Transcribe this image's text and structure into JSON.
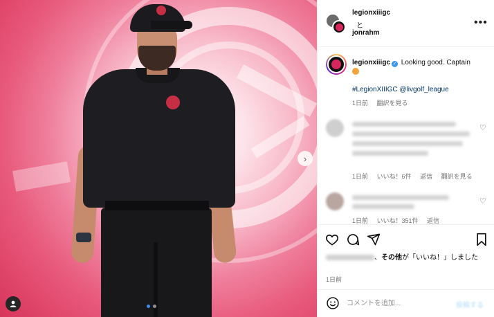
{
  "header": {
    "user1": "legionxiiigc",
    "conjunction": "と",
    "user2": "jonrahm",
    "more_icon": "more-horizontal-icon"
  },
  "caption": {
    "username": "legionxiiigc",
    "verified_icon": "verified-badge-icon",
    "text": "Looking good. Captain",
    "emoji_icon": "golf-emoji-icon",
    "tags": "#LegionXIIIGC @livgolf_league",
    "time": "1日前",
    "translate": "翻訳を見る"
  },
  "comments": [
    {
      "time": "1日前",
      "likes": "いいね！6件",
      "reply": "返信",
      "translate": "翻訳を見る"
    },
    {
      "time": "1日前",
      "likes": "いいね！351件",
      "reply": "返信"
    }
  ],
  "actions": {
    "like_icon": "heart-icon",
    "comment_icon": "comment-icon",
    "share_icon": "send-icon",
    "save_icon": "bookmark-icon"
  },
  "likes": {
    "connector": "、",
    "others": "その他",
    "suffix": "が「いいね！」しました"
  },
  "date": "1日前",
  "add_comment": {
    "placeholder": "コメントを追加...",
    "post_label": "投稿する"
  },
  "colors": {
    "link": "#00376b",
    "muted": "#737373",
    "brand_pink": "#d7265b",
    "verified": "#3897f0"
  }
}
